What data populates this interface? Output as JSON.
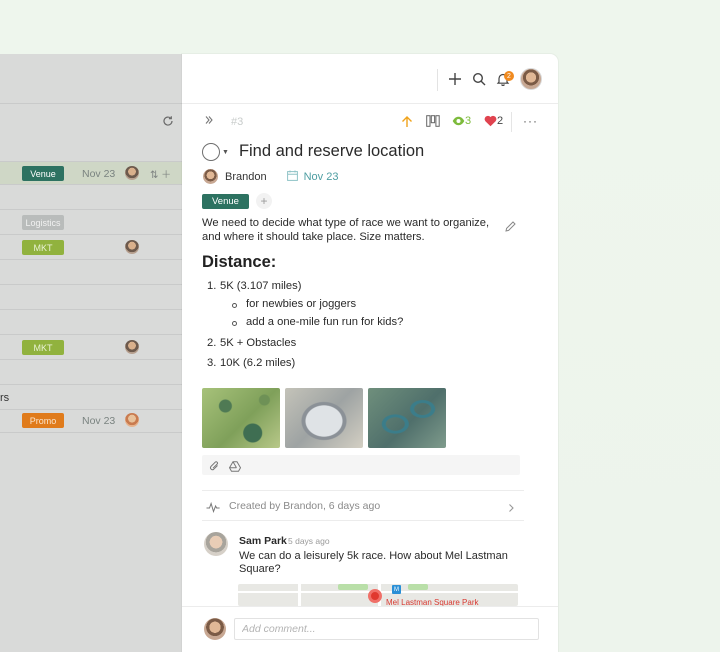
{
  "list": {
    "rows": [
      {
        "tag": "Venue",
        "date": "Nov 23"
      },
      {
        "tag": "Logistics",
        "date": ""
      },
      {
        "tag": "MKT",
        "date": ""
      },
      {
        "tag": "MKT",
        "date": ""
      },
      {
        "text": "rs"
      },
      {
        "tag": "Promo",
        "date": "Nov 23"
      }
    ]
  },
  "task": {
    "number": "#3",
    "title": "Find and reserve location",
    "assignee": "Brandon",
    "due_date": "Nov 23",
    "tag": "Venue",
    "add_tag": "+",
    "watchers_count": "3",
    "likes_count": "2",
    "notifications_count": "2",
    "description": "We need to decide what type of race we want to organize, and where it should take place. Size matters.",
    "heading": "Distance:",
    "list": [
      {
        "num": "1.",
        "text": "5K (3.107 miles)"
      },
      {
        "bullet": "for newbies or joggers"
      },
      {
        "bullet": "add a one-mile fun run for kids?"
      },
      {
        "num": "2.",
        "text": "5K + Obstacles"
      },
      {
        "num": "3.",
        "text": "10K (6.2 miles)"
      }
    ],
    "activity": "Created by Brandon, 6 days ago"
  },
  "comment": {
    "author": "Sam Park",
    "time": "5 days ago",
    "text": "We can do a leisurely 5k race. How about Mel Lastman Square?",
    "map_label": "Mel Lastman Square Park",
    "map_metro": "M"
  },
  "composer": {
    "placeholder": "Add comment..."
  },
  "colors": {
    "venue": "#2d7261",
    "mkt": "#91b23e",
    "promo": "#e07b1b",
    "accent_teal": "#4e9ea2",
    "priority": "#f0a31b",
    "watch": "#7dbb3c",
    "like": "#e0434f"
  }
}
